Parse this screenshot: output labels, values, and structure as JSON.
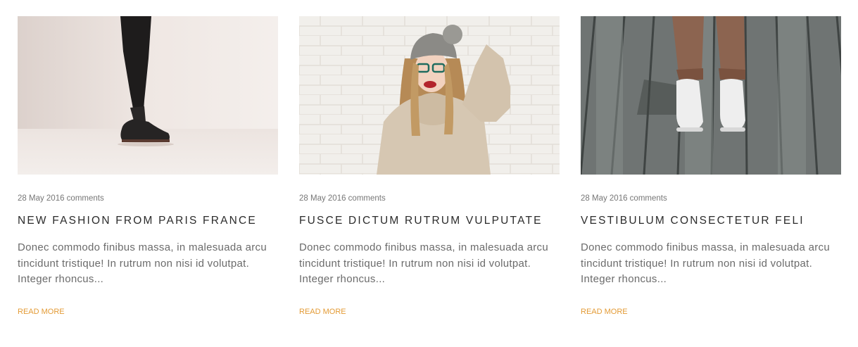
{
  "posts": [
    {
      "meta": "28 May 2016 comments",
      "title": "NEW FASHION FROM PARIS FRANCE",
      "excerpt": "Donec commodo finibus massa, in malesuada arcu tincidunt tristique! In rutrum non nisi id volutpat. Integer rhoncus...",
      "read_more": "READ MORE",
      "image": "person-black-sneakers-photo"
    },
    {
      "meta": "28 May 2016 comments",
      "title": "FUSCE DICTUM RUTRUM VULPUTATE",
      "excerpt": "Donec commodo finibus massa, in malesuada arcu tincidunt tristique! In rutrum non nisi id volutpat. Integer rhoncus...",
      "read_more": "READ MORE",
      "image": "woman-knit-sweater-photo"
    },
    {
      "meta": "28 May 2016 comments",
      "title": "VESTIBULUM CONSECTETUR FELI",
      "excerpt": "Donec commodo finibus massa, in malesuada arcu tincidunt tristique! In rutrum non nisi id volutpat. Integer rhoncus...",
      "read_more": "READ MORE",
      "image": "white-sneakers-wooden-deck-photo"
    }
  ],
  "colors": {
    "accent": "#e39b36",
    "title": "#2b2b2b",
    "text": "#6b6b6b",
    "meta": "#777777"
  }
}
